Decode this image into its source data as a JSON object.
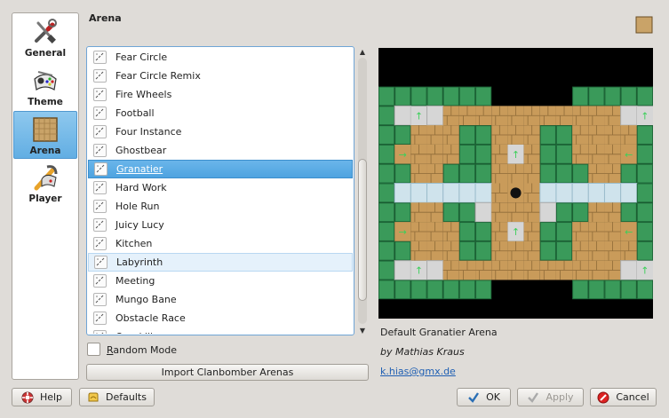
{
  "sidebar": {
    "items": [
      {
        "label": "General",
        "icon": "tools-icon",
        "selected": false
      },
      {
        "label": "Theme",
        "icon": "gamepad-theme-icon",
        "selected": false
      },
      {
        "label": "Arena",
        "icon": "arena-icon",
        "selected": true
      },
      {
        "label": "Player",
        "icon": "player-icon",
        "selected": false
      }
    ]
  },
  "header": {
    "title": "Arena"
  },
  "arena_list": {
    "items": [
      "Fear Circle",
      "Fear Circle Remix",
      "Fire Wheels",
      "Football",
      "Four Instance",
      "Ghostbear",
      "Granatier",
      "Hard Work",
      "Hole Run",
      "Juicy Lucy",
      "Kitchen",
      "Labyrinth",
      "Meeting",
      "Mungo Bane",
      "Obstacle Race",
      "Overkill"
    ],
    "selected": "Granatier",
    "hovered": "Labyrinth"
  },
  "random_mode": {
    "label_underlined": "R",
    "label_rest": "andom Mode",
    "checked": false
  },
  "import_button": {
    "label": "Import Clanbomber Arenas"
  },
  "preview": {
    "name": "Default Granatier Arena",
    "author": "by Mathias Kraus",
    "email": "k.hias@gmx.de"
  },
  "buttons": {
    "help": "Help",
    "defaults": "Defaults",
    "ok": "OK",
    "apply": "Apply",
    "cancel": "Cancel"
  },
  "colors": {
    "selection": "#4ea3e0",
    "grass": "#3a9a5a",
    "brick": "#c99b5a",
    "ice": "#cfe3ec",
    "link": "#1f5fb3"
  }
}
